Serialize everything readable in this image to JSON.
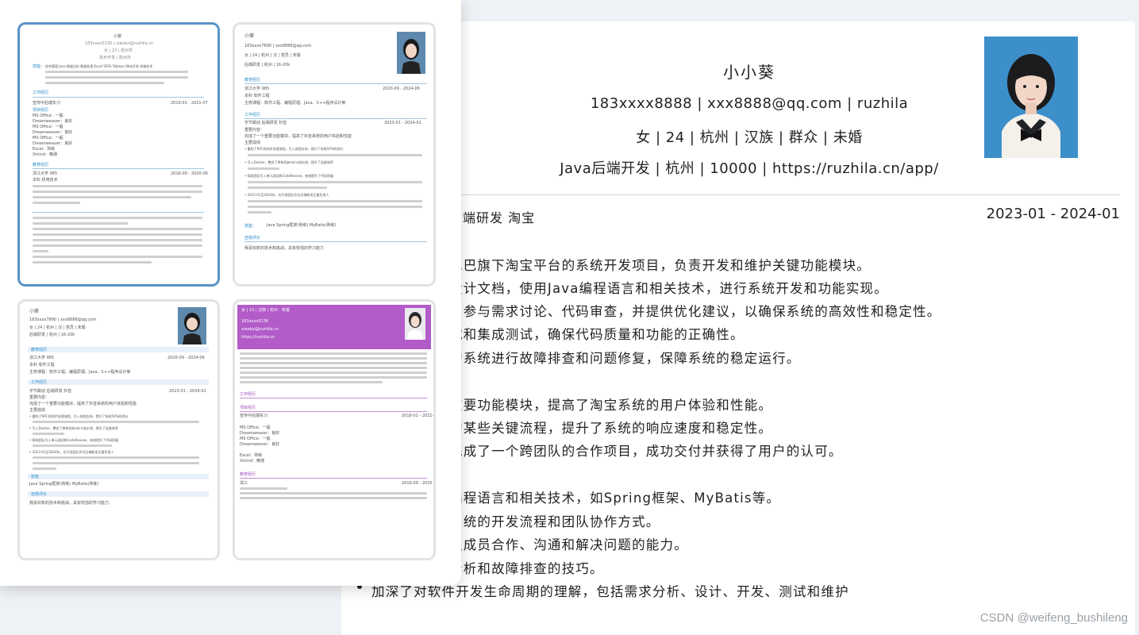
{
  "resume": {
    "name": "小小葵",
    "contact": "183xxxx8888 | xxx8888@qq.com | ruzhila",
    "basic": "女 | 24 | 杭州 | 汉族 | 群众 | 未婚",
    "intent": "Java后端开发 | 杭州 | 10000 | https://ruzhila.cn/app/",
    "job_left": "后端研发    淘宝",
    "job_date": "2023-01 - 2024-01",
    "paras": [
      "巴巴旗下淘宝平台的系统开发项目，负责开发和维护关键功能模块。",
      "设计文档，使用Java编程语言和相关技术，进行系统开发和功能实现。",
      "，参与需求讨论、代码审查，并提供优化建议，以确保系统的高效性和稳定性。",
      "试和集成测试，确保代码质量和功能的正确性。",
      "的系统进行故障排查和问题修复，保障系统的稳定运行。",
      "重要功能模块，提高了淘宝系统的用户体验和性能。",
      "的某些关键流程，提升了系统的响应速度和稳定性。",
      "完成了一个跨团队的合作项目，成功交付并获得了用户的认可。",
      "：",
      "编程语言和相关技术，如Spring框架、MyBatis等。",
      "系统的开发流程和团队协作方式。",
      "队成员合作、沟通和解决问题的能力。",
      "分析和故障排查的技巧。",
      "加深了对软件开发生命周期的理解，包括需求分析、设计、开发、测试和维护"
    ]
  },
  "templates": [
    {
      "name": "小葵",
      "contact": "183xxxx5136 | xiaokui@ruzhila.cn",
      "basic": "女 | 23 | 杭州市",
      "intent": "技术开发 | 杭州市",
      "skills_label": "技能：",
      "skills_text": "综合管理 Java 数据分析 数据处理 Excel SPSS Tableau Web开发 前端技术",
      "sec_work": "工作经历",
      "sec_edu": "教育经历",
      "sec_proj": "项目经历",
      "work_company": "宣传中后端实习",
      "work_date": "2019-01 - 2021-07",
      "lines": [
        "MS Office：一般",
        "Dreamweaver：良好",
        "MS Office：一般",
        "Dreamweaver：良好",
        "MS Office：一般",
        "Dreamweaver：良好",
        "Excel：熟练",
        "Xmind：精通"
      ],
      "edu_school": "浙江大学 985",
      "edu_date": "2016-09 - 2020-06",
      "edu_major": "本科  机电技术"
    },
    {
      "name": "小葵",
      "contact": "183xxxx7890 | xxx8888@qq.com",
      "basic": "女 | 24 | 杭州 | 汉 | 党员 | 未婚",
      "intent": "后端研发 | 杭州 | 16-20k",
      "sec_edu": "教育经历",
      "edu_school": "浙江大学 985",
      "edu_date": "2020-09 - 2024-06",
      "edu_major": "本科  软件工程",
      "edu_desc": "主修课程：软件工程、编程原理、Java、C++程序设计等",
      "sec_work": "工作经历",
      "work_company": "字节跳动  后端研发  抖音",
      "work_date": "2023-01 - 2024-01",
      "work_lines": [
        "重要内容：",
        "完成了一个重要功能模块，提高了抖音系统的用户体验和性能",
        "主要成绩",
        "• 重构了RPC的同步处理流程，引入协程支持，提升了系统50%的吞吐",
        "• 引入Docker，整合了原有的Jenkins流水线，提升了运维效率",
        "• 帮助团队引入单元测试和CodeReview，有效提升了代码质量",
        "• 2023-01至2024年，在开发团队作为后端研发主要负责人"
      ],
      "sec_skill": "技能：",
      "skill_text": "Java Spring框架(熟练) MyBatis(熟练)",
      "sec_self": "自我评价",
      "self_text": "我喜欢新的技术和挑战，具有较强的学习能力"
    },
    {
      "name": "小葵",
      "contact": "183xxxx7890 | xxx8888@qq.com",
      "basic": "女 | 24 | 杭州 | 汉 | 党员 | 未婚",
      "intent": "后端研发 | 杭州 | 16-20k",
      "sec_edu": "教育经历",
      "edu_school": "浙江大学 985",
      "edu_date": "2020-09 - 2024-06",
      "edu_major": "本科  软件工程",
      "edu_desc": "主修课程：软件工程、编程原理、Java、C++程序设计等",
      "sec_work": "工作经历",
      "work_company": "字节跳动  后端研发  抖音",
      "work_date": "2023-01 - 2024-01",
      "work_lines": [
        "重要内容：",
        "完成了一个重要功能模块，提高了抖音系统的用户体验和性能",
        "主要成绩",
        "• 重构了RPC的同步处理流程，引入协程支持，提升了系统50%的吞吐",
        "• 引入Docker，整合了原有的Jenkins流水线，提升了运维效率",
        "• 帮助团队引入单元测试和CodeReview，有效提升了代码质量",
        "• 2023-01至2024年，在开发团队作为后端研发主要负责人"
      ],
      "sec_skill": "技能",
      "skill_text": "Java Spring框架(熟练) MyBatis(熟练)",
      "sec_self": "自我评价",
      "self_text": "我喜欢新的技术和挑战，具有较强的学习能力"
    },
    {
      "basic": "女 | 23 | 汉族 | 杭州 · 未婚",
      "phone": "183xxxx5136",
      "email": "xiaokui@ruzhila.cn",
      "site": "https://ruzhila.cn",
      "sec_work": "工作经历",
      "sec_proj": "项目经历",
      "proj_name": "宣传中后端实习",
      "proj_date": "2018-01 - 2021-",
      "lines": [
        "MS Office：一般",
        "Dreamweaver：良好",
        "MS Office：一般",
        "Dreamweaver：良好",
        "Excel：熟练",
        "Xmind：精通"
      ],
      "sec_edu": "教育经历",
      "edu_school": "浙江",
      "edu_date": "2016-09 - 2020"
    }
  ],
  "watermark": "CSDN @weifeng_bushileng"
}
